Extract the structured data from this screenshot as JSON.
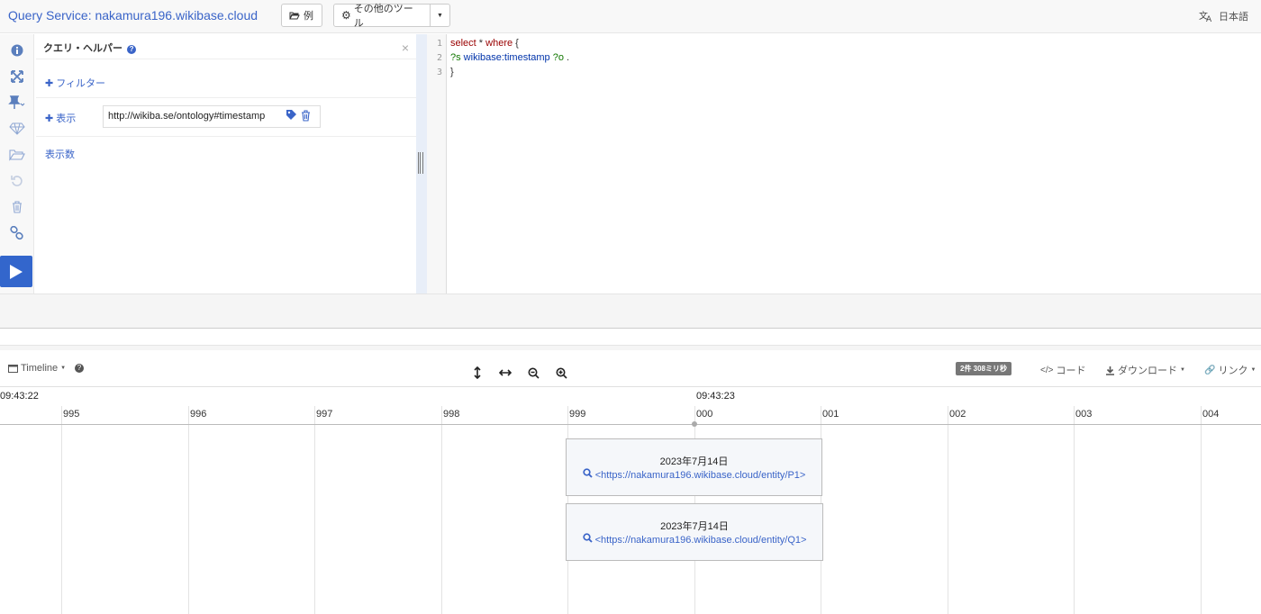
{
  "header": {
    "title": "Query Service: nakamura196.wikibase.cloud",
    "examples_label": "例",
    "tools_label": "その他のツール",
    "language_label": "日本語"
  },
  "helper": {
    "title": "クエリ・ヘルパー",
    "filter_label": "フィルター",
    "show_label": "表示",
    "show_value": "http://wikiba.se/ontology#timestamp",
    "limit_label": "表示数"
  },
  "editor": {
    "line_numbers": [
      "1",
      "2",
      "3"
    ],
    "line1": {
      "kw1": "select",
      "mid": " * ",
      "kw2": "where",
      "end": " {"
    },
    "line2": {
      "v1": "?s",
      "pred": " wikibase:timestamp ",
      "v2": "?o",
      "end": " ."
    },
    "line3": "}"
  },
  "results": {
    "view_label": "Timeline",
    "timing": "2件 308ミリ秒",
    "code_label": "コード",
    "download_label": "ダウンロード",
    "link_label": "リンク"
  },
  "timeline": {
    "major_labels": [
      "09:43:22",
      "09:43:23"
    ],
    "minor_labels": [
      "995",
      "996",
      "997",
      "998",
      "999",
      "000",
      "001",
      "002",
      "003",
      "004"
    ],
    "items": [
      {
        "date": "2023年7月14日",
        "uri": "<https://nakamura196.wikibase.cloud/entity/P1>"
      },
      {
        "date": "2023年7月14日",
        "uri": "<https://nakamura196.wikibase.cloud/entity/Q1>"
      }
    ]
  },
  "colors": {
    "brand": "#3a64c8",
    "run_button": "#3366cc",
    "timing_badge": "#777777"
  },
  "icons": [
    "info-icon",
    "expand-icon",
    "pin-icon",
    "gem-icon",
    "folder-icon",
    "history-icon",
    "trash-icon",
    "link-icon",
    "play-icon",
    "tag-icon",
    "calendar-icon",
    "help-icon",
    "zoom-in-icon",
    "zoom-out-icon",
    "search-icon"
  ]
}
